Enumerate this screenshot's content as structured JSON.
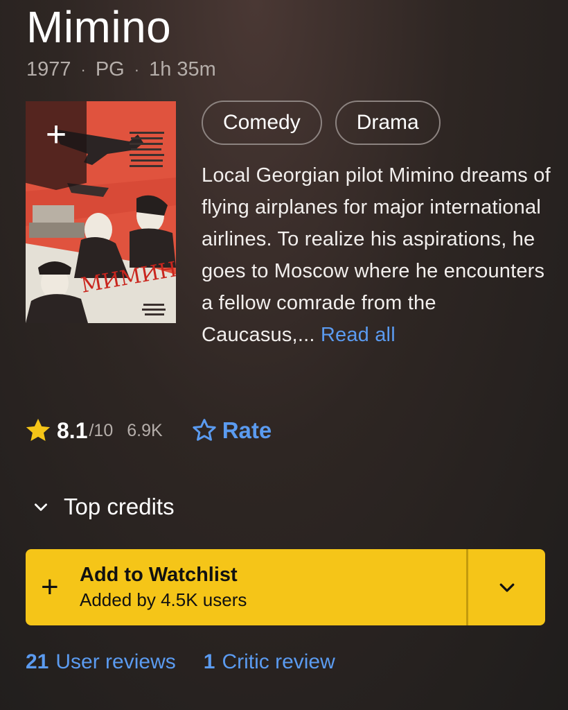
{
  "title": "Mimino",
  "meta": {
    "year": "1977",
    "rating": "PG",
    "runtime": "1h 35m"
  },
  "poster": {
    "title_text": "МИМИНО"
  },
  "genres": [
    "Comedy",
    "Drama"
  ],
  "plot": {
    "text": "Local Georgian pilot Mimino dreams of flying airplanes for major international airlines. To realize his aspirations, he goes to Moscow where he encounters a fellow comrade from the Caucasus,... ",
    "read_all": "Read all"
  },
  "rating": {
    "score": "8.1",
    "out_of": "/10",
    "votes": "6.9K",
    "rate_label": "Rate"
  },
  "credits": {
    "label": "Top credits"
  },
  "watchlist": {
    "title": "Add to Watchlist",
    "subtitle": "Added by 4.5K users"
  },
  "reviews": {
    "user_count": "21",
    "user_label": "User reviews",
    "critic_count": "1",
    "critic_label": "Critic review"
  },
  "colors": {
    "accent_yellow": "#f5c518",
    "link_blue": "#5b9bf0",
    "star": "#f5c518"
  },
  "icons": [
    "add-icon",
    "star-icon",
    "star-outline-icon",
    "chevron-down-icon",
    "plus-icon"
  ]
}
